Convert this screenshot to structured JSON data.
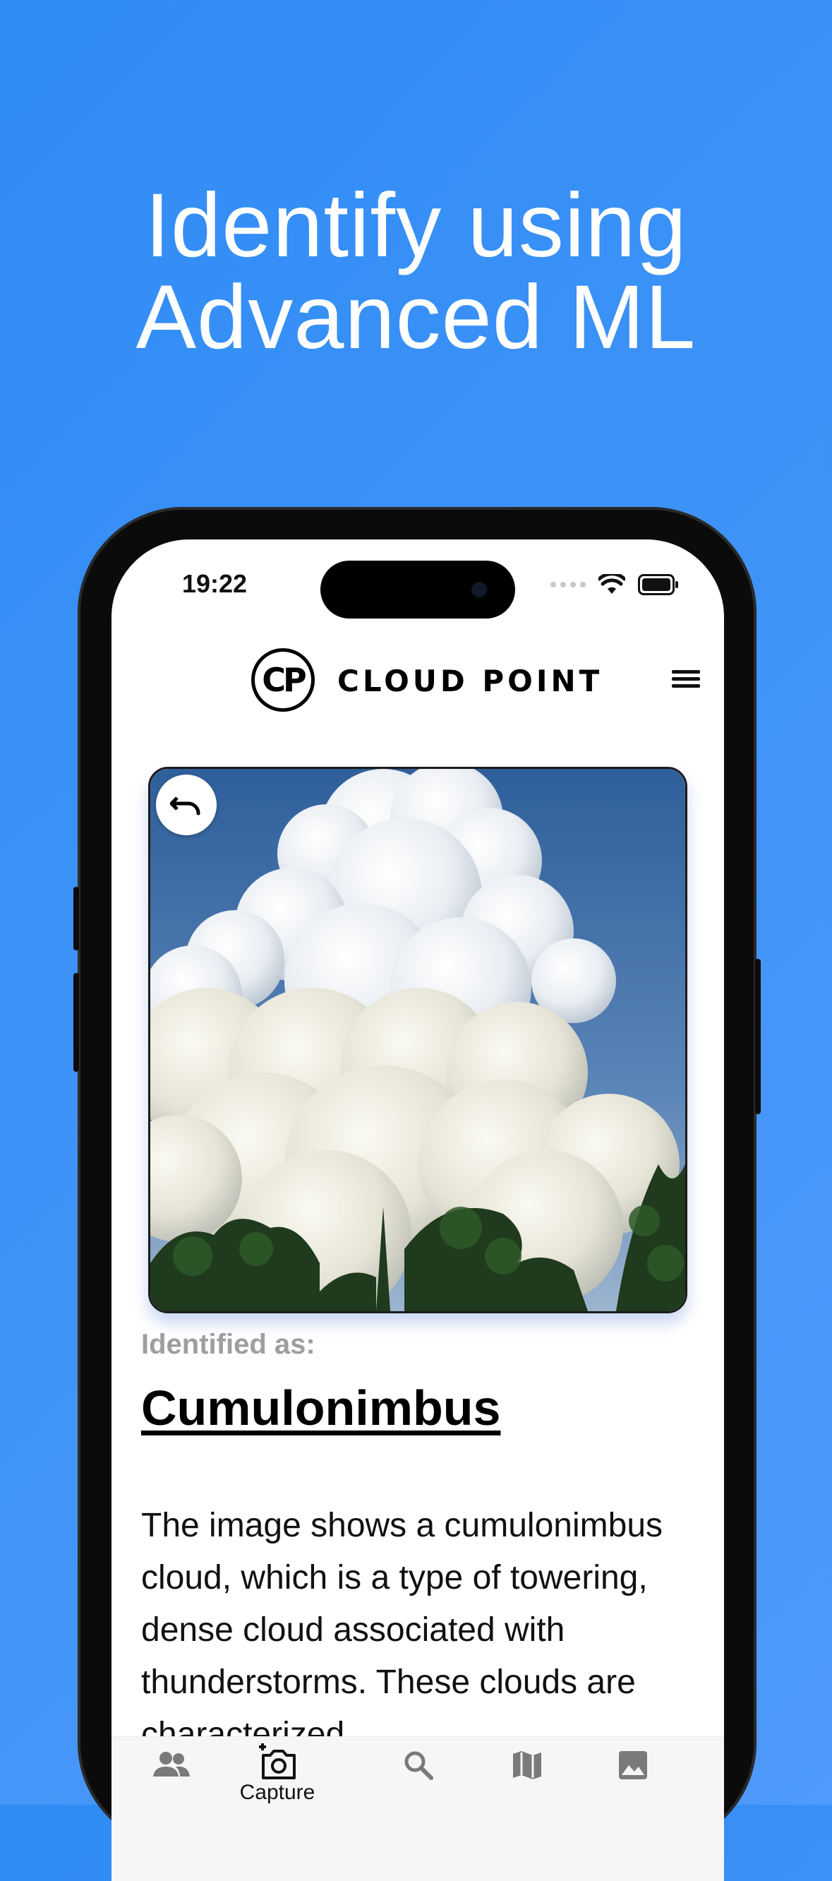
{
  "headline": {
    "line1": "Identify using",
    "line2": "Advanced ML"
  },
  "status_bar": {
    "time": "19:22"
  },
  "app": {
    "logo_monogram": "CP",
    "logo_text": "CLOUD POINT"
  },
  "result": {
    "label": "Identified as:",
    "name": "Cumulonimbus",
    "description": "The image shows a cumulonimbus cloud, which is a type of towering, dense cloud associated with thunderstorms. These clouds are characterized"
  },
  "bottom_nav": {
    "items": [
      {
        "label": "",
        "icon": "people-icon"
      },
      {
        "label": "Capture",
        "icon": "add-camera-icon"
      },
      {
        "label": "",
        "icon": "search-icon"
      },
      {
        "label": "",
        "icon": "map-icon"
      },
      {
        "label": "",
        "icon": "image-icon"
      }
    ]
  },
  "colors": {
    "background": "#3f93f7",
    "text_primary": "#000000",
    "label_gray": "#9e9e9e"
  }
}
